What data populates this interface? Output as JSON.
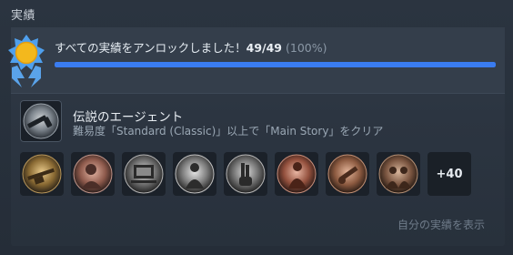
{
  "section": {
    "title": "実績"
  },
  "summary": {
    "text": "すべての実績をアンロックしました！",
    "count": "49/49",
    "percent": "(100%)",
    "progress": 1.0,
    "progress_color": "#3a7cf0",
    "medal_icon": "medal-ribbon-icon"
  },
  "featured": {
    "title": "伝説のエージェント",
    "description": "難易度「Standard (Classic)」以上で「Main Story」をクリア",
    "icon": "silenced-pistol-icon"
  },
  "achievement_icons": [
    {
      "name": "gold-rifle-icon"
    },
    {
      "name": "rose-portrait-icon"
    },
    {
      "name": "desk-scene-icon"
    },
    {
      "name": "monochrome-figure-icon"
    },
    {
      "name": "gloved-hand-icon"
    },
    {
      "name": "red-figure-icon"
    },
    {
      "name": "copper-arm-icon"
    },
    {
      "name": "bronze-group-icon"
    }
  ],
  "more_count": "+40",
  "show_link": "自分の実績を表示"
}
